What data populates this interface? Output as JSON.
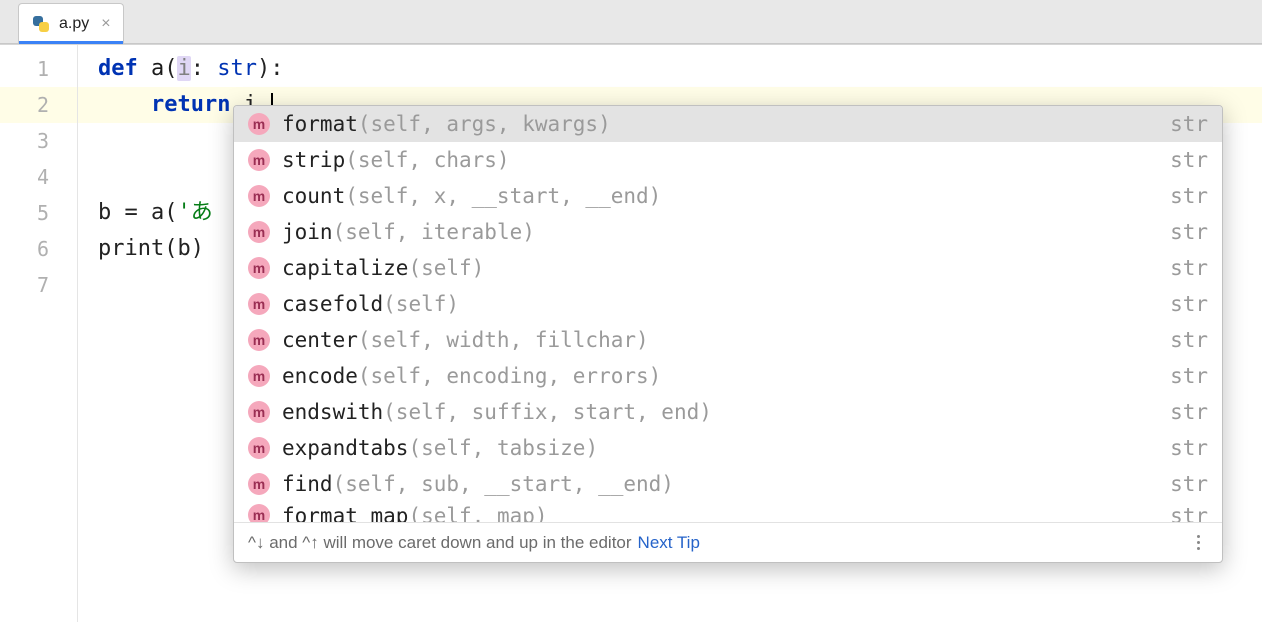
{
  "tab": {
    "filename": "a.py",
    "close_glyph": "×"
  },
  "gutter": {
    "line_numbers": [
      "1",
      "2",
      "3",
      "4",
      "5",
      "6",
      "7"
    ],
    "current_line_index": 1
  },
  "code": {
    "l1": {
      "kw_def": "def ",
      "fn": "a",
      "lp": "(",
      "p_i": "i",
      "colon": ": ",
      "type": "str",
      "rp": "):"
    },
    "l2": {
      "indent": "    ",
      "kw_return": "return ",
      "expr": "i",
      "dot": "."
    },
    "l3": "",
    "l4": "",
    "l5": {
      "lhs": "b = a(",
      "str": "'あ",
      "tail": ""
    },
    "l6": {
      "fn": "print",
      "lp": "(",
      "arg": "b",
      "rp": ")"
    },
    "l7": ""
  },
  "completion": {
    "badge_kind": "m",
    "selected_index": 0,
    "items": [
      {
        "name": "format",
        "params": "(self, args, kwargs)",
        "ret": "str"
      },
      {
        "name": "strip",
        "params": "(self, chars)",
        "ret": "str"
      },
      {
        "name": "count",
        "params": "(self, x, __start, __end)",
        "ret": "str"
      },
      {
        "name": "join",
        "params": "(self, iterable)",
        "ret": "str"
      },
      {
        "name": "capitalize",
        "params": "(self)",
        "ret": "str"
      },
      {
        "name": "casefold",
        "params": "(self)",
        "ret": "str"
      },
      {
        "name": "center",
        "params": "(self, width, fillchar)",
        "ret": "str"
      },
      {
        "name": "encode",
        "params": "(self, encoding, errors)",
        "ret": "str"
      },
      {
        "name": "endswith",
        "params": "(self, suffix, start, end)",
        "ret": "str"
      },
      {
        "name": "expandtabs",
        "params": "(self, tabsize)",
        "ret": "str"
      },
      {
        "name": "find",
        "params": "(self, sub, __start, __end)",
        "ret": "str"
      },
      {
        "name": "format_map",
        "params": "(self, map)",
        "ret": "str"
      }
    ],
    "footer_hint": "^↓ and ^↑ will move caret down and up in the editor",
    "next_tip_label": "Next Tip"
  }
}
